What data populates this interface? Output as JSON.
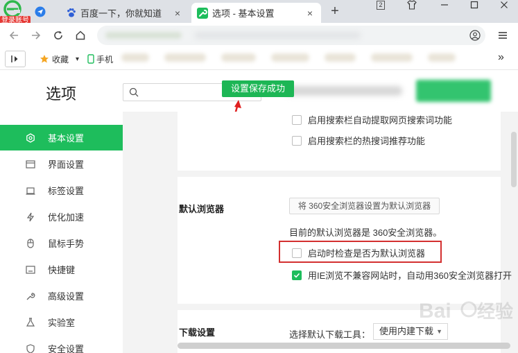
{
  "browser": {
    "login_badge": "登录账号",
    "tabs": [
      {
        "title": "百度一下，你就知道",
        "close": "×"
      },
      {
        "title": "选项 - 基本设置",
        "close": "×"
      }
    ],
    "new_tab": "+",
    "tab_count": "2",
    "bookmarks": [
      {
        "label": "收藏",
        "dropdown": "▾"
      },
      {
        "label": "手机"
      }
    ],
    "more": "»"
  },
  "page": {
    "title": "选项",
    "search_placeholder": "",
    "toast": "设置保存成功"
  },
  "sidebar": {
    "items": [
      {
        "label": "基本设置",
        "icon": "gear-icon",
        "active": true
      },
      {
        "label": "界面设置",
        "icon": "window-icon"
      },
      {
        "label": "标签设置",
        "icon": "tab-icon"
      },
      {
        "label": "优化加速",
        "icon": "lightning-icon"
      },
      {
        "label": "鼠标手势",
        "icon": "mouse-icon"
      },
      {
        "label": "快捷键",
        "icon": "keyboard-icon"
      },
      {
        "label": "高级设置",
        "icon": "wrench-icon"
      },
      {
        "label": "实验室",
        "icon": "flask-icon"
      },
      {
        "label": "安全设置",
        "icon": "shield-icon"
      }
    ]
  },
  "search_section": {
    "options": [
      {
        "label": "启用搜索栏自动提取网页搜索词功能",
        "checked": false
      },
      {
        "label": "启用搜索栏的热搜词推荐功能",
        "checked": false
      }
    ]
  },
  "default_browser": {
    "title": "默认浏览器",
    "set_default_button": "将 360安全浏览器设置为默认浏览器",
    "current": "目前的默认浏览器是 360安全浏览器。",
    "check_on_startup": {
      "label": "启动时检查是否为默认浏览器",
      "checked": false
    },
    "ie_fallback": {
      "label": "用IE浏览不兼容网站时，自动用360安全浏览器打开",
      "checked": true
    }
  },
  "download": {
    "title": "下载设置",
    "tool_label": "选择默认下载工具：",
    "tool_value": "使用内建下载"
  },
  "colors": {
    "accent": "#1ebd5c",
    "highlight_box": "#d32f2f",
    "badge": "#e53935"
  }
}
